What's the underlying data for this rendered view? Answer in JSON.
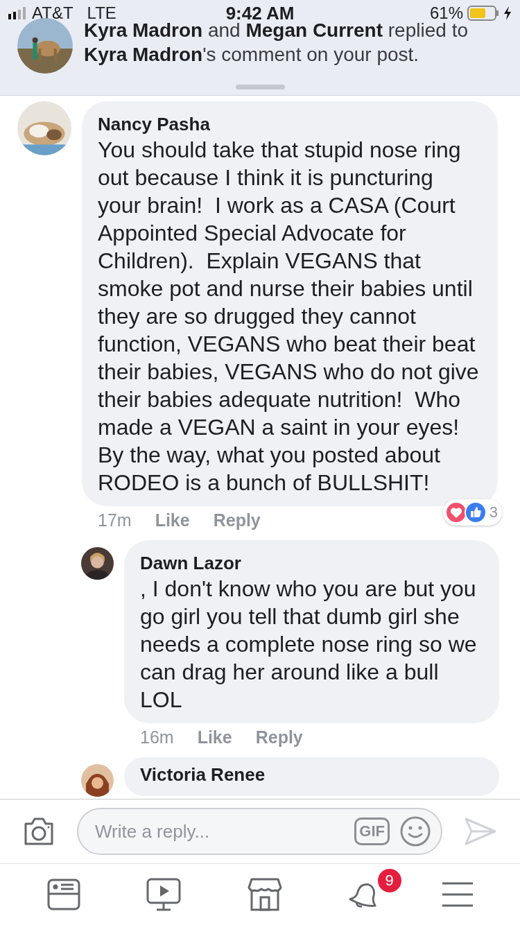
{
  "status_bar": {
    "carrier": "AT&T",
    "network": "LTE",
    "time": "9:42 AM",
    "battery": "61%"
  },
  "notification": {
    "text": "**Kyra Madron** and **Megan Current** replied to **Kyra Madron**'s comment on your post."
  },
  "comments": [
    {
      "author": "Nancy Pasha",
      "text": "You should take that stupid nose ring out because I think it is puncturing your brain!  I work as a CASA (Court Appointed Special Advocate for Children).  Explain VEGANS that smoke pot and nurse their babies until they are so drugged they cannot function, VEGANS who beat their beat their babies, VEGANS who do not give their babies adequate nutrition!  Who made a VEGAN a saint in your eyes!  By the way, what you posted about RODEO is a bunch of BULLSHIT!",
      "time": "17m",
      "like": "Like",
      "reply": "Reply",
      "reaction_count": "3",
      "children": [
        {
          "author": "Dawn Lazor",
          "text": ", I don't know who you are but you go girl you tell that dumb girl she needs a complete nose ring so we can drag her around like a bull LOL",
          "time": "16m",
          "like": "Like",
          "reply": "Reply"
        },
        {
          "author": "Victoria Renee"
        }
      ]
    }
  ],
  "composer": {
    "placeholder": "Write a reply...",
    "gif": "GIF"
  },
  "tab_bar": {
    "notification_badge": "9"
  }
}
